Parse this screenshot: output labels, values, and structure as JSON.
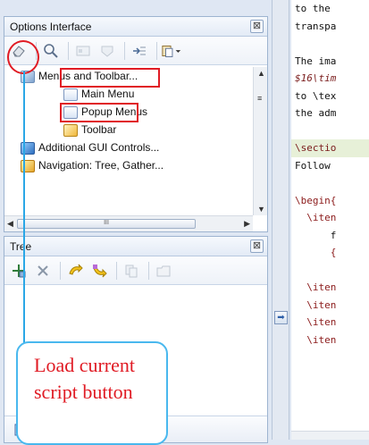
{
  "options_panel": {
    "title": "Options Interface",
    "tree_items": [
      {
        "label": "Menus and Toolbar...",
        "icon": "menu-folder-icon"
      },
      {
        "label": "Main Menu",
        "icon": "menu-page-icon"
      },
      {
        "label": "Popup Menus",
        "icon": "popup-page-icon"
      },
      {
        "label": "Toolbar",
        "icon": "toolbar-icon"
      },
      {
        "label": "Additional GUI Controls...",
        "icon": "gui-controls-icon"
      },
      {
        "label": "Navigation: Tree, Gather...",
        "icon": "navigation-icon"
      }
    ],
    "scroll_thumb_text": "III"
  },
  "tree_panel": {
    "title": "Tree"
  },
  "annotation": {
    "line1": "Load current",
    "line2": "script button"
  },
  "editor": {
    "lines": [
      {
        "text": "to the ",
        "style": ""
      },
      {
        "text": "transpa",
        "style": ""
      },
      {
        "text": "",
        "style": ""
      },
      {
        "text": "The ima",
        "style": ""
      },
      {
        "text": "$16\\tim",
        "style": "it"
      },
      {
        "text": "to \\tex",
        "style": ""
      },
      {
        "text": "the adm",
        "style": ""
      },
      {
        "text": "",
        "style": ""
      },
      {
        "text": "\\sectio",
        "style": "sec"
      },
      {
        "text": "Follow ",
        "style": ""
      },
      {
        "text": "",
        "style": ""
      },
      {
        "text": "\\begin{",
        "style": "kw"
      },
      {
        "text": "  \\iten",
        "style": "kw"
      },
      {
        "text": "      f",
        "style": ""
      },
      {
        "text": "      {",
        "style": "kw"
      },
      {
        "text": "",
        "style": ""
      },
      {
        "text": "  \\iten",
        "style": "kw"
      },
      {
        "text": "  \\iten",
        "style": "kw"
      },
      {
        "text": "  \\iten",
        "style": "kw"
      },
      {
        "text": "  \\iten",
        "style": "kw"
      }
    ]
  },
  "colors": {
    "highlight_red": "#e01b24",
    "callout_blue": "#49b8ee"
  }
}
